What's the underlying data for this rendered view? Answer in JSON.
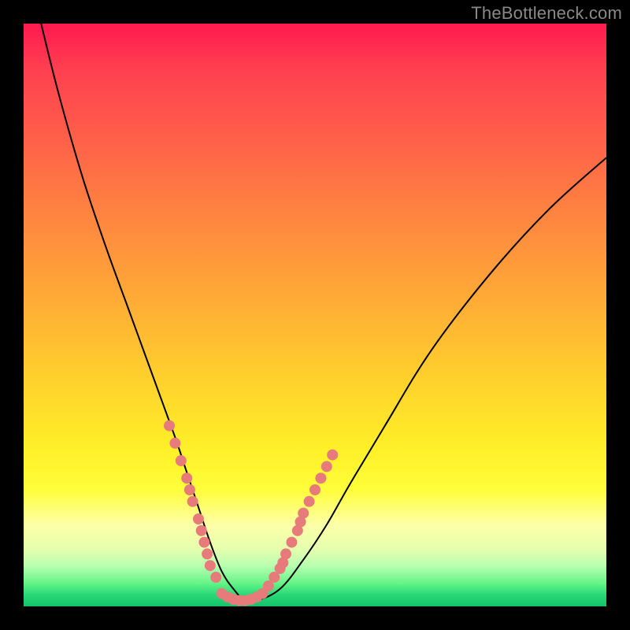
{
  "watermark": "TheBottleneck.com",
  "chart_data": {
    "type": "line",
    "title": "",
    "xlabel": "",
    "ylabel": "",
    "xlim": [
      0,
      100
    ],
    "ylim": [
      0,
      100
    ],
    "series": [
      {
        "name": "curve",
        "color": "#000000",
        "x": [
          3,
          6,
          10,
          14,
          18,
          22,
          26,
          28,
          30,
          32,
          34,
          36,
          38,
          40,
          44,
          48,
          52,
          56,
          62,
          70,
          80,
          90,
          100
        ],
        "y": [
          100,
          88,
          74,
          62,
          51,
          40,
          29,
          23,
          17,
          11,
          6,
          3,
          1,
          1,
          3,
          8,
          14,
          21,
          31,
          44,
          57,
          68,
          77
        ]
      }
    ],
    "markers": [
      {
        "name": "beads-left",
        "color": "#e77b7b",
        "x": [
          25,
          26,
          27,
          28,
          28.5,
          29,
          30,
          30.5,
          31,
          31.5,
          32,
          33
        ],
        "y": [
          31,
          28,
          25,
          22,
          20,
          18,
          15,
          13,
          11,
          9,
          7,
          5
        ]
      },
      {
        "name": "beads-bottom",
        "color": "#e77b7b",
        "x": [
          34,
          35,
          36,
          37,
          38,
          39,
          40,
          41
        ],
        "y": [
          2.2,
          1.6,
          1.2,
          1.0,
          1.0,
          1.2,
          1.6,
          2.2
        ]
      },
      {
        "name": "beads-right",
        "color": "#e77b7b",
        "x": [
          42,
          43,
          44,
          44.5,
          45,
          46,
          47,
          47.5,
          48,
          49,
          50,
          51,
          52,
          53
        ],
        "y": [
          3.5,
          5,
          6.5,
          7.5,
          9,
          11,
          13,
          14.5,
          16,
          18,
          20,
          22,
          24,
          26
        ]
      }
    ]
  }
}
